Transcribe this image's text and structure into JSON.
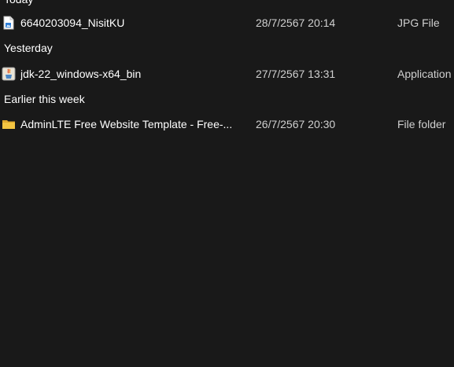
{
  "groups": [
    {
      "header": "Today",
      "items": [
        {
          "name": "6640203094_NisitKU",
          "date_modified": "28/7/2567 20:14",
          "type": "JPG File",
          "icon": "image-file-icon"
        }
      ]
    },
    {
      "header": "Yesterday",
      "items": [
        {
          "name": "jdk-22_windows-x64_bin",
          "date_modified": "27/7/2567 13:31",
          "type": "Application",
          "icon": "installer-app-icon"
        }
      ]
    },
    {
      "header": "Earlier this week",
      "items": [
        {
          "name": "AdminLTE Free Website Template - Free-...",
          "date_modified": "26/7/2567 20:30",
          "type": "File folder",
          "icon": "folder-icon"
        }
      ]
    }
  ],
  "colors": {
    "background": "#191919",
    "text_primary": "#ffffff",
    "text_secondary": "#d0d0d0",
    "folder_yellow": "#f4c542",
    "image_icon_blue": "#2f7fd8"
  }
}
